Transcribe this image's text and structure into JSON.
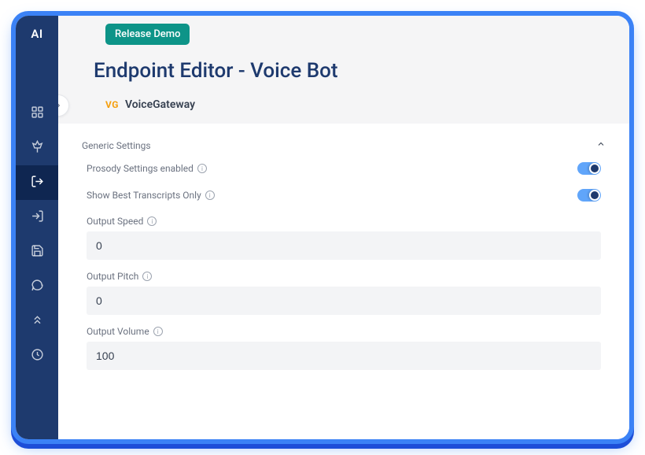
{
  "sidebar": {
    "logo": "AI",
    "items": [
      {
        "name": "dashboard",
        "icon": "grid"
      },
      {
        "name": "pin",
        "icon": "pin"
      },
      {
        "name": "export",
        "icon": "logout",
        "active": true
      },
      {
        "name": "import",
        "icon": "login"
      },
      {
        "name": "save",
        "icon": "save"
      },
      {
        "name": "chat",
        "icon": "chat"
      },
      {
        "name": "deploy",
        "icon": "chevrons-up"
      },
      {
        "name": "settings",
        "icon": "clock"
      }
    ]
  },
  "header": {
    "badge": "Release Demo",
    "title": "Endpoint Editor - Voice Bot",
    "vg_prefix": "VG",
    "vg_name": "VoiceGateway"
  },
  "panel": {
    "heading": "Generic Settings",
    "toggles": {
      "prosody": {
        "label": "Prosody Settings enabled",
        "on": true
      },
      "transcripts": {
        "label": "Show Best Transcripts Only",
        "on": true
      }
    },
    "fields": {
      "speed": {
        "label": "Output Speed",
        "value": "0"
      },
      "pitch": {
        "label": "Output Pitch",
        "value": "0"
      },
      "volume": {
        "label": "Output Volume",
        "value": "100"
      }
    }
  }
}
